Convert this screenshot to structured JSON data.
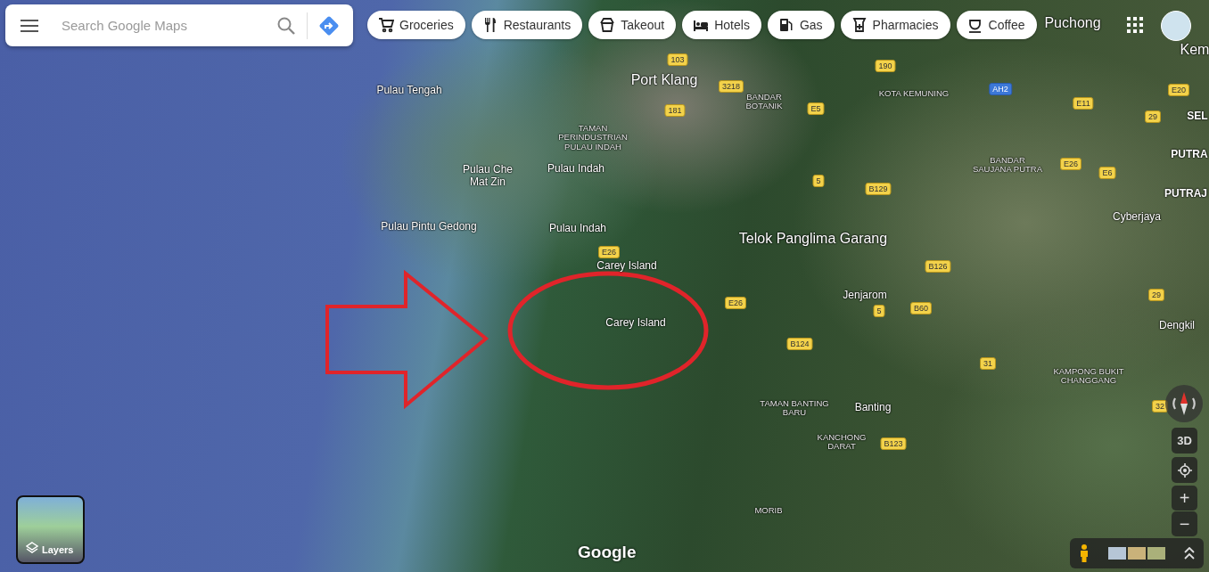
{
  "search": {
    "placeholder": "Search Google Maps"
  },
  "chips": [
    {
      "label": "Groceries",
      "kind": "cart"
    },
    {
      "label": "Restaurants",
      "kind": "fork"
    },
    {
      "label": "Takeout",
      "kind": "bag"
    },
    {
      "label": "Hotels",
      "kind": "bed"
    },
    {
      "label": "Gas",
      "kind": "pump"
    },
    {
      "label": "Pharmacies",
      "kind": "pharmacy"
    },
    {
      "label": "Coffee",
      "kind": "cup"
    }
  ],
  "map_labels": [
    {
      "text": "Port Klang",
      "kind": "city"
    },
    {
      "text": "Pulau Tengah",
      "kind": "place"
    },
    {
      "text": "Pulau Che Mat Zin",
      "kind": "place"
    },
    {
      "text": "Pulau Pintu Gedong",
      "kind": "place"
    },
    {
      "text": "TAMAN PERINDUSTRIAN PULAU INDAH",
      "kind": "area"
    },
    {
      "text": "Pulau Indah",
      "kind": "place"
    },
    {
      "text": "Pulau Indah",
      "kind": "place"
    },
    {
      "text": "Carey Island",
      "kind": "place"
    },
    {
      "text": "Carey Island",
      "kind": "place"
    },
    {
      "text": "BANDAR BOTANIK",
      "kind": "area"
    },
    {
      "text": "KOTA KEMUNING",
      "kind": "area"
    },
    {
      "text": "BANDAR SAUJANA PUTRA",
      "kind": "area"
    },
    {
      "text": "Puchong",
      "kind": "city"
    },
    {
      "text": "Kem",
      "kind": "city"
    },
    {
      "text": "SEL",
      "kind": "region"
    },
    {
      "text": "PUTRA",
      "kind": "region"
    },
    {
      "text": "PUTRAJ",
      "kind": "region"
    },
    {
      "text": "Telok Panglima Garang",
      "kind": "city"
    },
    {
      "text": "Jenjarom",
      "kind": "place"
    },
    {
      "text": "Cyberjaya",
      "kind": "place"
    },
    {
      "text": "Dengkil",
      "kind": "place"
    },
    {
      "text": "KAMPONG BUKIT CHANGGANG",
      "kind": "area"
    },
    {
      "text": "TAMAN BANTING BARU",
      "kind": "area"
    },
    {
      "text": "Banting",
      "kind": "place"
    },
    {
      "text": "KANCHONG DARAT",
      "kind": "area"
    },
    {
      "text": "MORIB",
      "kind": "area"
    },
    {
      "text": "103",
      "kind": "road"
    },
    {
      "text": "3218",
      "kind": "road"
    },
    {
      "text": "181",
      "kind": "road"
    },
    {
      "text": "190",
      "kind": "road"
    },
    {
      "text": "E5",
      "kind": "road"
    },
    {
      "text": "AH2",
      "kind": "highway"
    },
    {
      "text": "E11",
      "kind": "road"
    },
    {
      "text": "E20",
      "kind": "road"
    },
    {
      "text": "29",
      "kind": "road"
    },
    {
      "text": "5",
      "kind": "road"
    },
    {
      "text": "B129",
      "kind": "road"
    },
    {
      "text": "E26",
      "kind": "road"
    },
    {
      "text": "E6",
      "kind": "road"
    },
    {
      "text": "B126",
      "kind": "road"
    },
    {
      "text": "5",
      "kind": "road"
    },
    {
      "text": "B60",
      "kind": "road"
    },
    {
      "text": "E26",
      "kind": "road"
    },
    {
      "text": "E26",
      "kind": "road"
    },
    {
      "text": "B124",
      "kind": "road"
    },
    {
      "text": "31",
      "kind": "road"
    },
    {
      "text": "32",
      "kind": "road"
    },
    {
      "text": "B123",
      "kind": "road"
    },
    {
      "text": "29",
      "kind": "road"
    }
  ],
  "layers": {
    "label": "Layers"
  },
  "attribution": "Google",
  "controls": {
    "three_d": "3D",
    "zoom_in": "+",
    "zoom_out": "−"
  }
}
